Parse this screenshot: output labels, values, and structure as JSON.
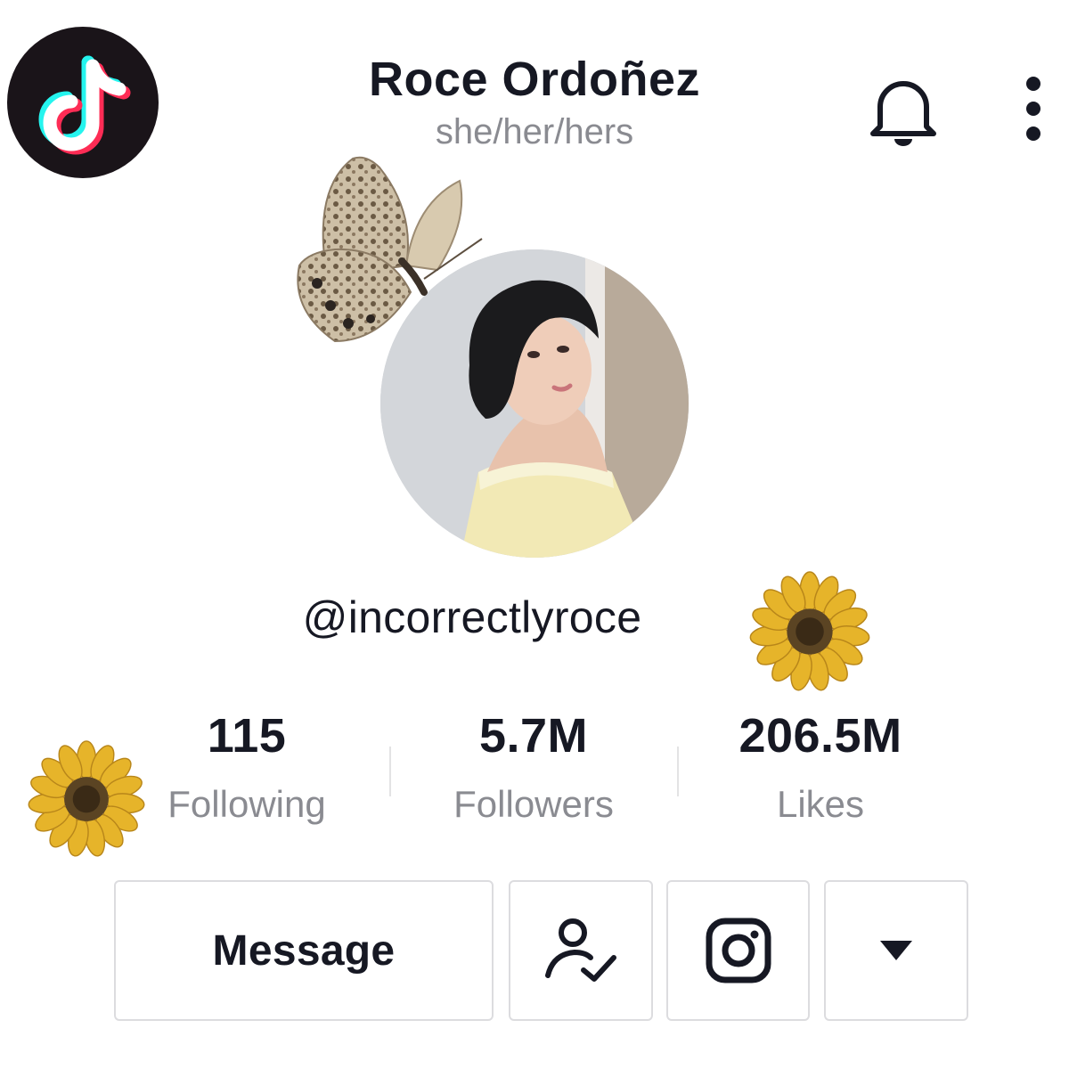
{
  "profile": {
    "display_name": "Roce Ordoñez",
    "pronouns": "she/her/hers",
    "username": "@incorrectlyroce"
  },
  "stats": [
    {
      "value": "115",
      "label": "Following"
    },
    {
      "value": "5.7M",
      "label": "Followers"
    },
    {
      "value": "206.5M",
      "label": "Likes"
    }
  ],
  "actions": {
    "message_label": "Message"
  },
  "icons": {
    "logo": "tiktok-logo",
    "notifications": "bell-icon",
    "more": "vertical-dots-icon",
    "following": "user-check-icon",
    "instagram": "instagram-icon",
    "dropdown": "caret-down-icon",
    "decorations": [
      "butterfly",
      "sunflower",
      "sunflower"
    ]
  },
  "colors": {
    "text_primary": "#161823",
    "text_secondary": "#8a8b91",
    "tiktok_cyan": "#25f4ee",
    "tiktok_pink": "#fe2c55",
    "border": "#dcdcdf"
  }
}
